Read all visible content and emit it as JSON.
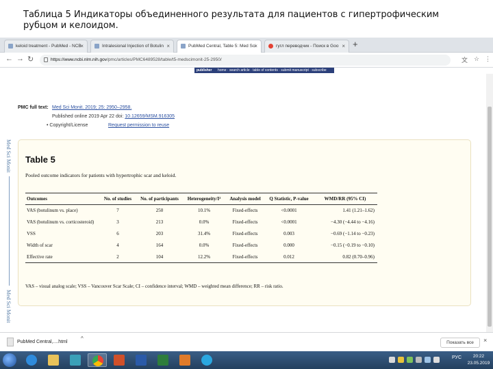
{
  "slide": {
    "title": "Таблица 5 Индикаторы объединенного результата для пациентов с гипертрофическим рубцом и келоидом."
  },
  "browser": {
    "tabs": [
      {
        "label": "keloid treatment - PubMed - NCB"
      },
      {
        "label": "Intralesional Injection of Botulin"
      },
      {
        "label": "PubMed Central, Table 5: Med Sci"
      },
      {
        "label": "гугл переводчик - Поиск в Goo"
      }
    ],
    "new_tab": "+",
    "url_domain": "https://www.ncbi.nlm.nih.gov",
    "url_path": "/pmc/articles/PMC6489528/table/t5-medscimonit-25-2950/",
    "banner": {
      "logo": "publisher",
      "links": "home · search article · table of contents · submit manuscript · subscribe"
    }
  },
  "article": {
    "side_label": "Med Sci Monit",
    "pmc_label": "PMC full text:",
    "citation": "Med Sci Monit. 2019; 25: 2950–2958.",
    "published": "Published online 2019 Apr 22",
    "doi_prefix": "doi:",
    "doi": "10.12659/MSM.916305",
    "copyright": "Copyright/License",
    "permission": "Request permission to reuse"
  },
  "table": {
    "title": "Table 5",
    "caption": "Pooled outcome indicators for patients with hypertrophic scar and keloid.",
    "headers": [
      "Outcomes",
      "No. of studies",
      "No. of participants",
      "Heterogeneity/I²",
      "Analysis model",
      "Q Statistic, P-value",
      "WMD/RR (95% CI)"
    ],
    "rows": [
      [
        "VAS (botulinum vs. place)",
        "7",
        "250",
        "10.1%",
        "Fixed-effects",
        "<0.0001",
        "1.41 (1.21–1.62)"
      ],
      [
        "VAS (botulinum vs. corticosteroid)",
        "3",
        "213",
        "0.0%",
        "Fixed-effects",
        "<0.0001",
        "−4.30 (−4.44 to −4.16)"
      ],
      [
        "VSS",
        "6",
        "203",
        "31.4%",
        "Fixed-effects",
        "0.003",
        "−0.69 (−1.14 to −0.23)"
      ],
      [
        "Width of scar",
        "4",
        "164",
        "0.0%",
        "Fixed-effects",
        "0.000",
        "−0.15 (−0.19 to −0.10)"
      ],
      [
        "Effective rate",
        "2",
        "104",
        "12.2%",
        "Fixed-effects",
        "0.012",
        "0.82 (0.70–0.96)"
      ]
    ],
    "footnote": "VAS – visual analog scale; VSS – Vancouver Scar Scale; CI – confidence interval; WMD – weighted mean difference; RR – risk ratio."
  },
  "downloads": {
    "file": "PubMed Central,....html",
    "show_all": "Показать все"
  },
  "taskbar": {
    "lang": "РУС",
    "time": "20:22",
    "date": "23.05.2019"
  }
}
